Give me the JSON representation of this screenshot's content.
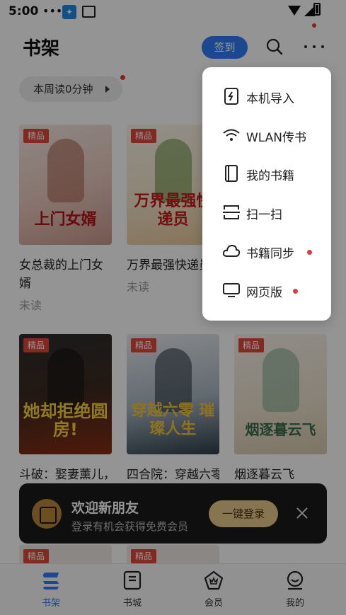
{
  "status_bar": {
    "time": "5:00",
    "dots": "•••"
  },
  "header": {
    "title": "书架",
    "signin_label": "签到"
  },
  "reading": {
    "week_label": "本周读0分钟"
  },
  "books": [
    {
      "badge": "精品",
      "cover_text": "上门女婿",
      "title": "女总裁的上门女婿",
      "status": "未读"
    },
    {
      "badge": "精品",
      "cover_text": "万界最强快递员",
      "title": "万界最强快递员",
      "status": "未读"
    },
    {
      "badge": "精品",
      "cover_text": "她却拒绝圆房!",
      "title": "斗破：娶妻薰儿，她却拒绝圆房",
      "status": ""
    },
    {
      "badge": "精品",
      "cover_text": "穿越六零 璀璨人生",
      "title": "四合院：穿越六零璀璨人生",
      "status": ""
    },
    {
      "badge": "精品",
      "cover_text": "烟逐暮云飞",
      "title": "烟逐暮云飞",
      "status": ""
    }
  ],
  "peek_books": [
    {
      "badge": "精品"
    },
    {
      "badge": "精品"
    }
  ],
  "banner": {
    "title": "欢迎新朋友",
    "subtitle": "登录有机会获得免费会员",
    "login_label": "一键登录"
  },
  "tabs": [
    {
      "label": "书架",
      "icon": "bookshelf-icon",
      "active": true
    },
    {
      "label": "书城",
      "icon": "book-city-icon",
      "active": false
    },
    {
      "label": "会员",
      "icon": "member-icon",
      "active": false
    },
    {
      "label": "我的",
      "icon": "profile-icon",
      "active": false
    }
  ],
  "menu": {
    "items": [
      {
        "label": "本机导入",
        "icon": "import-icon",
        "dot": false
      },
      {
        "label": "WLAN传书",
        "icon": "wifi-icon",
        "dot": false
      },
      {
        "label": "我的书籍",
        "icon": "book-icon",
        "dot": false
      },
      {
        "label": "扫一扫",
        "icon": "scan-icon",
        "dot": false
      },
      {
        "label": "书籍同步",
        "icon": "cloud-icon",
        "dot": true
      },
      {
        "label": "网页版",
        "icon": "monitor-icon",
        "dot": true
      }
    ]
  },
  "colors": {
    "accent": "#2f7cf6",
    "badge": "#e0493a",
    "dot": "#e53935",
    "banner_bg": "#1b1b1b",
    "login_btn": "#e8c98a"
  }
}
